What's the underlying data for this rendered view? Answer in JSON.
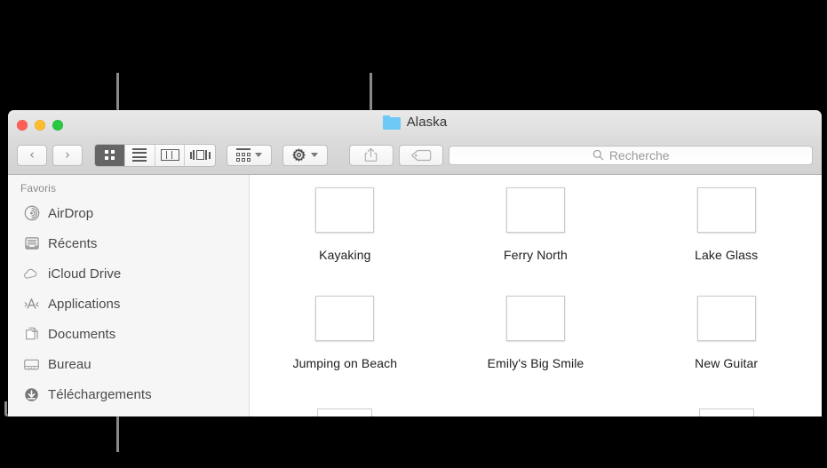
{
  "window": {
    "title": "Alaska",
    "folder_icon": "folder-icon",
    "traffic_lights": {
      "close": "close-window-button",
      "minimize": "minimize-window-button",
      "zoom": "zoom-window-button"
    }
  },
  "toolbar": {
    "back_label": "‹",
    "forward_label": "›",
    "view_modes": [
      {
        "name": "icon-view",
        "label": "Icônes",
        "active": true
      },
      {
        "name": "list-view",
        "label": "Liste",
        "active": false
      },
      {
        "name": "column-view",
        "label": "Colonnes",
        "active": false
      },
      {
        "name": "gallery-view",
        "label": "Galerie",
        "active": false
      }
    ],
    "arrange_label": "Regrouper",
    "action_label": "Action",
    "share_label": "Partager",
    "tag_label": "Étiquettes"
  },
  "search": {
    "placeholder": "Recherche",
    "value": ""
  },
  "sidebar": {
    "header": "Favoris",
    "items": [
      {
        "label": "AirDrop",
        "icon": "airdrop-icon"
      },
      {
        "label": "Récents",
        "icon": "recents-icon"
      },
      {
        "label": "iCloud Drive",
        "icon": "icloud-icon"
      },
      {
        "label": "Applications",
        "icon": "applications-icon"
      },
      {
        "label": "Documents",
        "icon": "documents-icon"
      },
      {
        "label": "Bureau",
        "icon": "desktop-icon"
      },
      {
        "label": "Téléchargements",
        "icon": "downloads-icon"
      }
    ]
  },
  "content": {
    "files": [
      {
        "label": "Kayaking",
        "art": "pic-kayaking"
      },
      {
        "label": "Ferry North",
        "art": "pic-ferry"
      },
      {
        "label": "Lake Glass",
        "art": "pic-lake"
      },
      {
        "label": "Jumping on Beach",
        "art": "pic-jumping"
      },
      {
        "label": "Emily's Big Smile",
        "art": "pic-emily"
      },
      {
        "label": "New Guitar",
        "art": "pic-guitar"
      }
    ]
  },
  "colors": {
    "accent_folder": "#6fc9f7",
    "callout": "#8a8a8a",
    "titlebar": "#e4e4e4",
    "sidebar_bg": "#f6f6f6",
    "selected_segment": "#656565"
  }
}
